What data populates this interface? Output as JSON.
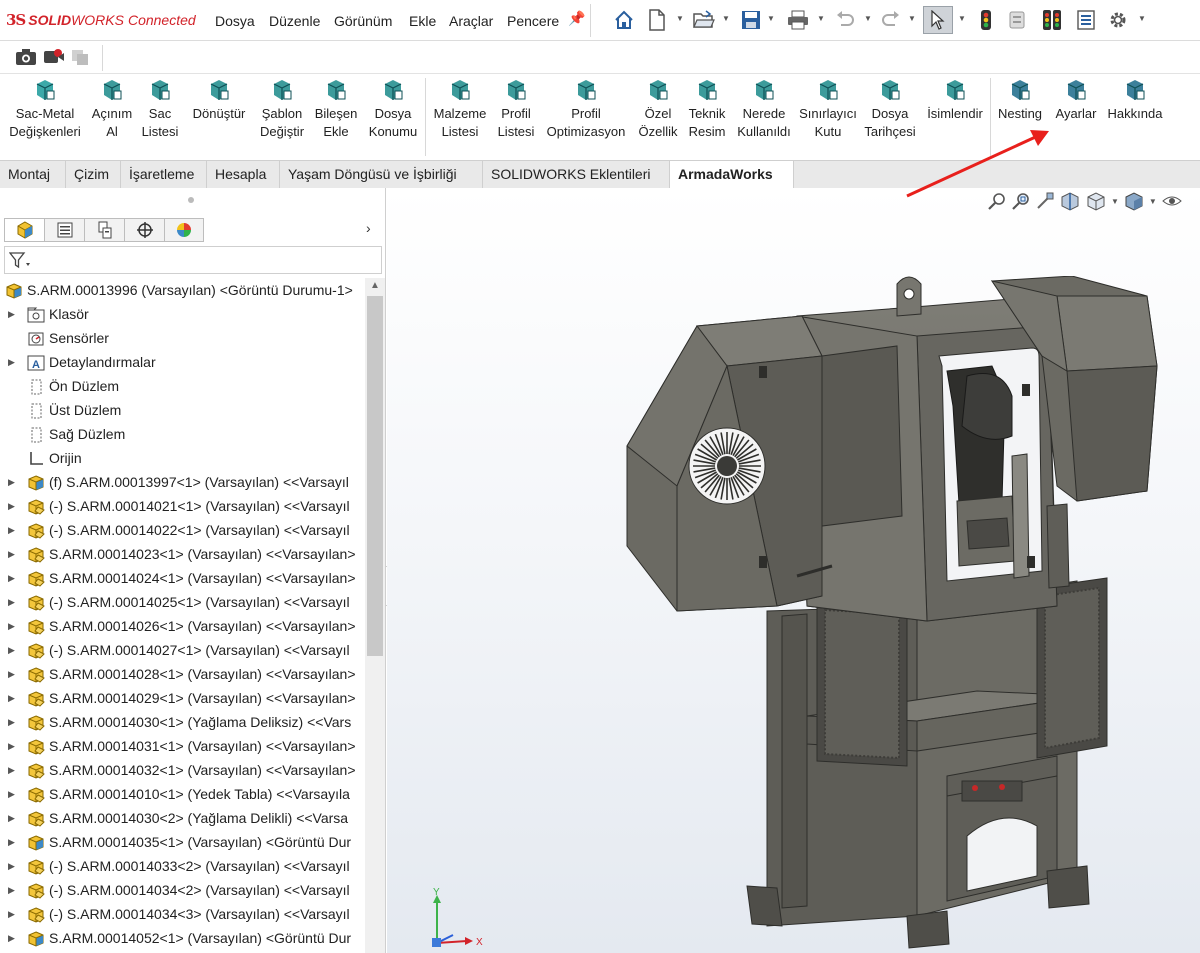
{
  "app": {
    "logo_ds": "3S",
    "logo_solid": "SOLID",
    "logo_works": "WORKS",
    "logo_connected": "Connected"
  },
  "menu": [
    "Dosya",
    "Düzenle",
    "Görünüm",
    "Ekle",
    "Araçlar",
    "Pencere"
  ],
  "command_manager": {
    "groups": [
      [
        {
          "l1": "Sac-Metal",
          "l2": "Değişkenleri",
          "icon": "sheet-metal-variables-icon",
          "color": "#1a9a9a"
        },
        {
          "l1": "Açınım",
          "l2": "Al",
          "icon": "unfold-icon",
          "color": "#1a8a8a"
        },
        {
          "l1": "Sac",
          "l2": "Listesi",
          "icon": "sheet-list-icon",
          "color": "#1a8a8a"
        },
        {
          "l1": "Dönüştür",
          "l2": "",
          "icon": "convert-icon",
          "color": "#1a8a8a"
        },
        {
          "l1": "Şablon",
          "l2": "Değiştir",
          "icon": "template-change-icon",
          "color": "#1a8a8a"
        },
        {
          "l1": "Bileşen",
          "l2": "Ekle",
          "icon": "add-component-icon",
          "color": "#1a8a8a"
        },
        {
          "l1": "Dosya",
          "l2": "Konumu",
          "icon": "file-location-icon",
          "color": "#1a8a8a"
        }
      ],
      [
        {
          "l1": "Malzeme",
          "l2": "Listesi",
          "icon": "material-list-icon",
          "color": "#1a8a8a"
        },
        {
          "l1": "Profil",
          "l2": "Listesi",
          "icon": "profile-list-icon",
          "color": "#1a8a8a"
        },
        {
          "l1": "Profil",
          "l2": "Optimizasyon",
          "icon": "profile-optimization-icon",
          "color": "#1a8a8a"
        },
        {
          "l1": "Özel",
          "l2": "Özellik",
          "icon": "custom-property-icon",
          "color": "#1a8a8a"
        },
        {
          "l1": "Teknik",
          "l2": "Resim",
          "icon": "technical-drawing-icon",
          "color": "#1a8a8a"
        },
        {
          "l1": "Nerede",
          "l2": "Kullanıldı",
          "icon": "where-used-icon",
          "color": "#1a8a8a"
        },
        {
          "l1": "Sınırlayıcı",
          "l2": "Kutu",
          "icon": "bounding-box-icon",
          "color": "#1a8a8a"
        },
        {
          "l1": "Dosya",
          "l2": "Tarihçesi",
          "icon": "file-history-icon",
          "color": "#1a8a8a"
        },
        {
          "l1": "İsimlendir",
          "l2": "",
          "icon": "rename-icon",
          "color": "#1a8a8a"
        }
      ],
      [
        {
          "l1": "Nesting",
          "l2": "",
          "icon": "nesting-icon",
          "color": "#1a6a8a"
        },
        {
          "l1": "Ayarlar",
          "l2": "",
          "icon": "settings-icon",
          "color": "#1a6a8a"
        },
        {
          "l1": "Hakkında",
          "l2": "",
          "icon": "about-icon",
          "color": "#1a6a8a"
        }
      ]
    ]
  },
  "tabs": [
    "Montaj",
    "Çizim",
    "İşaretleme",
    "Hesapla",
    "Yaşam Döngüsü ve İşbirliği",
    "SOLIDWORKS Eklentileri",
    "ArmadaWorks"
  ],
  "active_tab": "ArmadaWorks",
  "tree": {
    "root": "S.ARM.00013996 (Varsayılan) <Görüntü Durumu-1>",
    "items": [
      {
        "text": "Klasör",
        "kind": "folder",
        "expand": true
      },
      {
        "text": "Sensörler",
        "kind": "sensor",
        "expand": false
      },
      {
        "text": "Detaylandırmalar",
        "kind": "annotation",
        "expand": true
      },
      {
        "text": "Ön Düzlem",
        "kind": "plane",
        "expand": false
      },
      {
        "text": "Üst Düzlem",
        "kind": "plane",
        "expand": false
      },
      {
        "text": "Sağ Düzlem",
        "kind": "plane",
        "expand": false
      },
      {
        "text": "Orijin",
        "kind": "origin",
        "expand": false
      },
      {
        "text": "(f) S.ARM.00013997<1> (Varsayılan) <<Varsayıl",
        "kind": "asm",
        "expand": true
      },
      {
        "text": "(-) S.ARM.00014021<1> (Varsayılan) <<Varsayıl",
        "kind": "part",
        "expand": true
      },
      {
        "text": "(-) S.ARM.00014022<1> (Varsayılan) <<Varsayıl",
        "kind": "part",
        "expand": true
      },
      {
        "text": "S.ARM.00014023<1> (Varsayılan) <<Varsayılan>",
        "kind": "part",
        "expand": true
      },
      {
        "text": "S.ARM.00014024<1> (Varsayılan) <<Varsayılan>",
        "kind": "part",
        "expand": true
      },
      {
        "text": "(-) S.ARM.00014025<1> (Varsayılan) <<Varsayıl",
        "kind": "part",
        "expand": true
      },
      {
        "text": "S.ARM.00014026<1> (Varsayılan) <<Varsayılan>",
        "kind": "part",
        "expand": true
      },
      {
        "text": "(-) S.ARM.00014027<1> (Varsayılan) <<Varsayıl",
        "kind": "part",
        "expand": true
      },
      {
        "text": "S.ARM.00014028<1> (Varsayılan) <<Varsayılan>",
        "kind": "part",
        "expand": true
      },
      {
        "text": "S.ARM.00014029<1> (Varsayılan) <<Varsayılan>",
        "kind": "part",
        "expand": true
      },
      {
        "text": "S.ARM.00014030<1> (Yağlama Deliksiz) <<Vars",
        "kind": "part",
        "expand": true
      },
      {
        "text": "S.ARM.00014031<1> (Varsayılan) <<Varsayılan>",
        "kind": "part",
        "expand": true
      },
      {
        "text": "S.ARM.00014032<1> (Varsayılan) <<Varsayılan>",
        "kind": "part",
        "expand": true
      },
      {
        "text": "S.ARM.00014010<1> (Yedek Tabla) <<Varsayıla",
        "kind": "part",
        "expand": true
      },
      {
        "text": "S.ARM.00014030<2> (Yağlama Delikli) <<Varsa",
        "kind": "part",
        "expand": true
      },
      {
        "text": "S.ARM.00014035<1> (Varsayılan) <Görüntü Dur",
        "kind": "asm",
        "expand": true
      },
      {
        "text": "(-) S.ARM.00014033<2> (Varsayılan) <<Varsayıl",
        "kind": "part",
        "expand": true
      },
      {
        "text": "(-) S.ARM.00014034<2> (Varsayılan) <<Varsayıl",
        "kind": "part",
        "expand": true
      },
      {
        "text": "(-) S.ARM.00014034<3> (Varsayılan) <<Varsayıl",
        "kind": "part",
        "expand": true
      },
      {
        "text": "S.ARM.00014052<1> (Varsayılan) <Görüntü Dur",
        "kind": "asm",
        "expand": true
      }
    ]
  },
  "triad": {
    "x": "X",
    "y": "Y"
  },
  "colors": {
    "accent": "#d2232a",
    "model": "#6b6a63",
    "model_dark": "#4d4c47",
    "model_light": "#8a8982",
    "arrow": "#e8201c"
  }
}
